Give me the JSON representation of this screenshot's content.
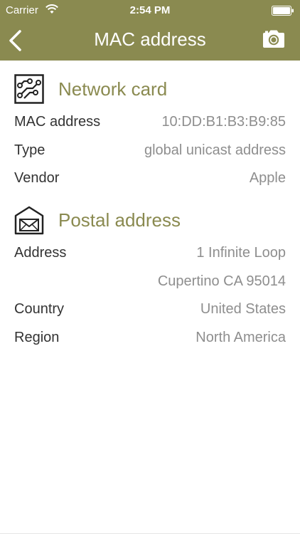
{
  "status_bar": {
    "carrier": "Carrier",
    "time": "2:54 PM"
  },
  "nav": {
    "title": "MAC address",
    "back_icon": "chevron-left-icon",
    "action_icon": "camera-icon"
  },
  "colors": {
    "accent": "#8a8a50",
    "label": "#333333",
    "value": "#8e8e8e"
  },
  "network_card": {
    "title": "Network card",
    "icon": "circuit-board-icon",
    "rows": [
      {
        "label": "MAC address",
        "value": "10:DD:B1:B3:B9:85"
      },
      {
        "label": "Type",
        "value": "global unicast address"
      },
      {
        "label": "Vendor",
        "value": "Apple"
      }
    ]
  },
  "postal_address": {
    "title": "Postal address",
    "icon": "mailbox-envelope-icon",
    "address_label": "Address",
    "address_line1": "1 Infinite Loop",
    "address_line2": "Cupertino CA 95014",
    "rows": [
      {
        "label": "Country",
        "value": "United States"
      },
      {
        "label": "Region",
        "value": "North America"
      }
    ]
  }
}
